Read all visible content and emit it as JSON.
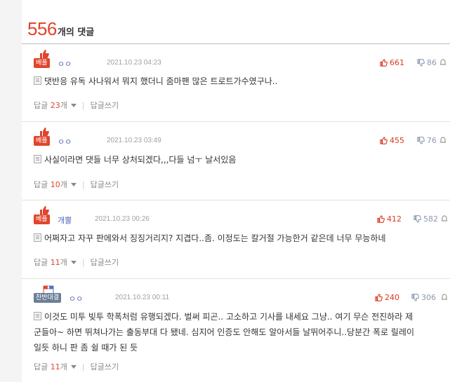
{
  "header": {
    "count": "556",
    "count_label": "개의 댓글"
  },
  "comments": [
    {
      "badge": "베플",
      "badge_type": "best",
      "author": "ㅇㅇ",
      "date": "2021.10.23 04:23",
      "likes": "661",
      "dislikes": "86",
      "text": "댓반응 유독 사나워서 뭐지 했더니 줌마팬 많은 트로트가수였구나..",
      "reply_label": "답글 ",
      "reply_count": "23",
      "reply_unit": "개",
      "write_reply": "답글쓰기"
    },
    {
      "badge": "베플",
      "badge_type": "best",
      "author": "ㅇㅇ",
      "date": "2021.10.23 03:49",
      "likes": "455",
      "dislikes": "76",
      "text": "사실이라면 댓들 너무 상처되겠다,,,다들 넘ㅜ 날서있음",
      "reply_label": "답글 ",
      "reply_count": "10",
      "reply_unit": "개",
      "write_reply": "답글쓰기"
    },
    {
      "badge": "베플",
      "badge_type": "best",
      "author": "개뿔",
      "date": "2021.10.23 00:26",
      "likes": "412",
      "dislikes": "582",
      "text": "어쩌자고 자꾸 판에와서 징징거리지? 지겹다..좀. 이정도는 칼거절 가능한거 같은데 너무 무능하네",
      "reply_label": "답글 ",
      "reply_count": "11",
      "reply_unit": "개",
      "write_reply": "답글쓰기"
    },
    {
      "badge": "찬반대결",
      "badge_type": "debate",
      "author": "ㅇㅇ",
      "date": "2021.10.23 00:11",
      "likes": "240",
      "dislikes": "306",
      "text_lines": [
        "이것도 미투 빚투 학폭처럼 유행되겠다. 벌써 피곤.. 고소하고 기사를 내세요 그냥.. 여기 무슨 전진하라 제",
        "군들아~ 하면 뛰쳐나가는 출동부대 다 됐네. 심지어 인증도 안해도 알아서들 날뛰어주니..당분간 폭로 릴레이",
        "일듯 하니 판 좀 쉴 때가 된 듯"
      ],
      "reply_label": "답글 ",
      "reply_count": "11",
      "reply_unit": "개",
      "write_reply": "답글쓰기"
    }
  ],
  "colors": {
    "accent": "#e0452d",
    "debate_badge": "#6a7f96",
    "dislike": "#8a9bb0",
    "background": "#f4f4f4"
  },
  "icons": {
    "best_badge": "thumbs-up-icon",
    "debate_badge": "flags-icon",
    "like": "thumbs-up-icon",
    "dislike": "thumbs-down-icon",
    "report": "siren-icon",
    "body": "document-icon",
    "reply_toggle": "caret-down-icon"
  }
}
